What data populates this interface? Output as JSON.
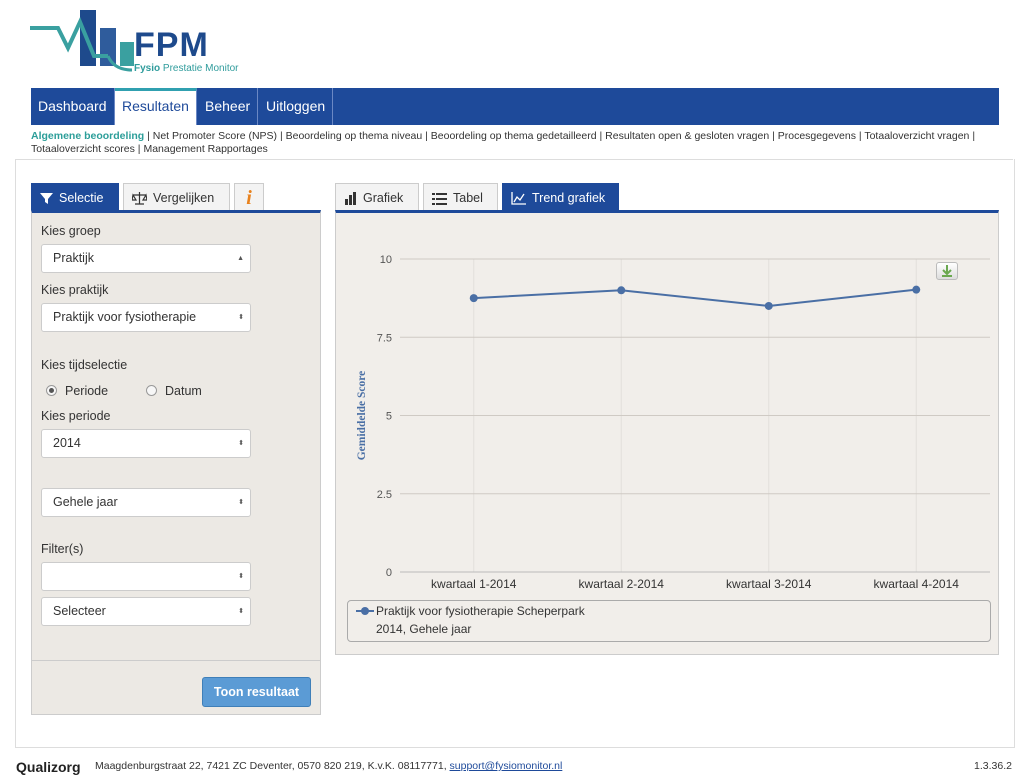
{
  "brand": {
    "logo_text": "FPM",
    "logo_sub_bold": "Fysio",
    "logo_sub": "Prestatie Monitor"
  },
  "nav": {
    "items": [
      "Dashboard",
      "Resultaten",
      "Beheer",
      "Uitloggen"
    ],
    "active": "Resultaten"
  },
  "subnav": {
    "active": "Algemene beoordeling",
    "items": [
      "Net Promoter Score (NPS)",
      "Beoordeling op thema niveau",
      "Beoordeling op thema gedetailleerd",
      "Resultaten open & gesloten vragen",
      "Procesgegevens",
      "Totaaloverzicht vragen",
      "Totaaloverzicht scores",
      "Management Rapportages"
    ]
  },
  "left_tabs": {
    "selectie": "Selectie",
    "vergelijken": "Vergelijken",
    "info": "i"
  },
  "filters": {
    "groep_label": "Kies groep",
    "groep_value": "Praktijk",
    "praktijk_label": "Kies praktijk",
    "praktijk_value": "Praktijk voor fysiotherapie",
    "tijd_label": "Kies tijdselectie",
    "radio_periode": "Periode",
    "radio_datum": "Datum",
    "periode_label": "Kies periode",
    "periode_value": "2014",
    "jaar_value": "Gehele jaar",
    "filters_label": "Filter(s)",
    "filter1_value": "",
    "filter2_value": "Selecteer",
    "submit_label": "Toon resultaat"
  },
  "right_tabs": {
    "grafiek": "Grafiek",
    "tabel": "Tabel",
    "trend": "Trend grafiek"
  },
  "chart_data": {
    "type": "line",
    "categories": [
      "kwartaal 1-2014",
      "kwartaal 2-2014",
      "kwartaal 3-2014",
      "kwartaal 4-2014"
    ],
    "series": [
      {
        "name": "Praktijk voor fysiotherapie Scheperpark",
        "values": [
          8.75,
          9.0,
          8.5,
          9.02
        ]
      }
    ],
    "legend_subtitle": "2014, Gehele jaar",
    "ylabel": "Gemiddelde Score",
    "xlabel": "",
    "ylim": [
      0,
      10
    ],
    "yticks": [
      "0",
      "2.5",
      "5",
      "7.5",
      "10"
    ],
    "grid": true,
    "legend_position": "bottom",
    "line_color": "#4a6fa5"
  },
  "footer": {
    "brand": "Qualizorg",
    "address": "Maagdenburgstraat 22, 7421 ZC Deventer, 0570 820 219, K.v.K. 08117771,",
    "email": "support@fysiomonitor.nl",
    "version": "1.3.36.2"
  }
}
